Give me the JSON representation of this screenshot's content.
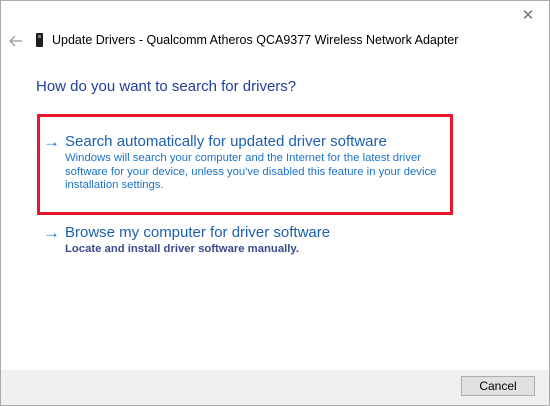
{
  "window": {
    "title": "Update Drivers - Qualcomm Atheros QCA9377 Wireless Network Adapter",
    "close_glyph": "✕",
    "back_icon": "back-arrow-icon",
    "device_icon": "network-adapter-icon"
  },
  "main": {
    "question": "How do you want to search for drivers?",
    "options": [
      {
        "arrow": "→",
        "title": "Search automatically for updated driver software",
        "description": "Windows will search your computer and the Internet for the latest driver software for your device, unless you've disabled this feature in your device installation settings.",
        "highlighted": true
      },
      {
        "arrow": "→",
        "title": "Browse my computer for driver software",
        "description": "Locate and install driver software manually.",
        "highlighted": false
      }
    ]
  },
  "footer": {
    "cancel_label": "Cancel"
  },
  "colors": {
    "highlight_border": "#e8182a",
    "link_blue": "#1b5fb0",
    "question_blue": "#1f3f9a"
  }
}
